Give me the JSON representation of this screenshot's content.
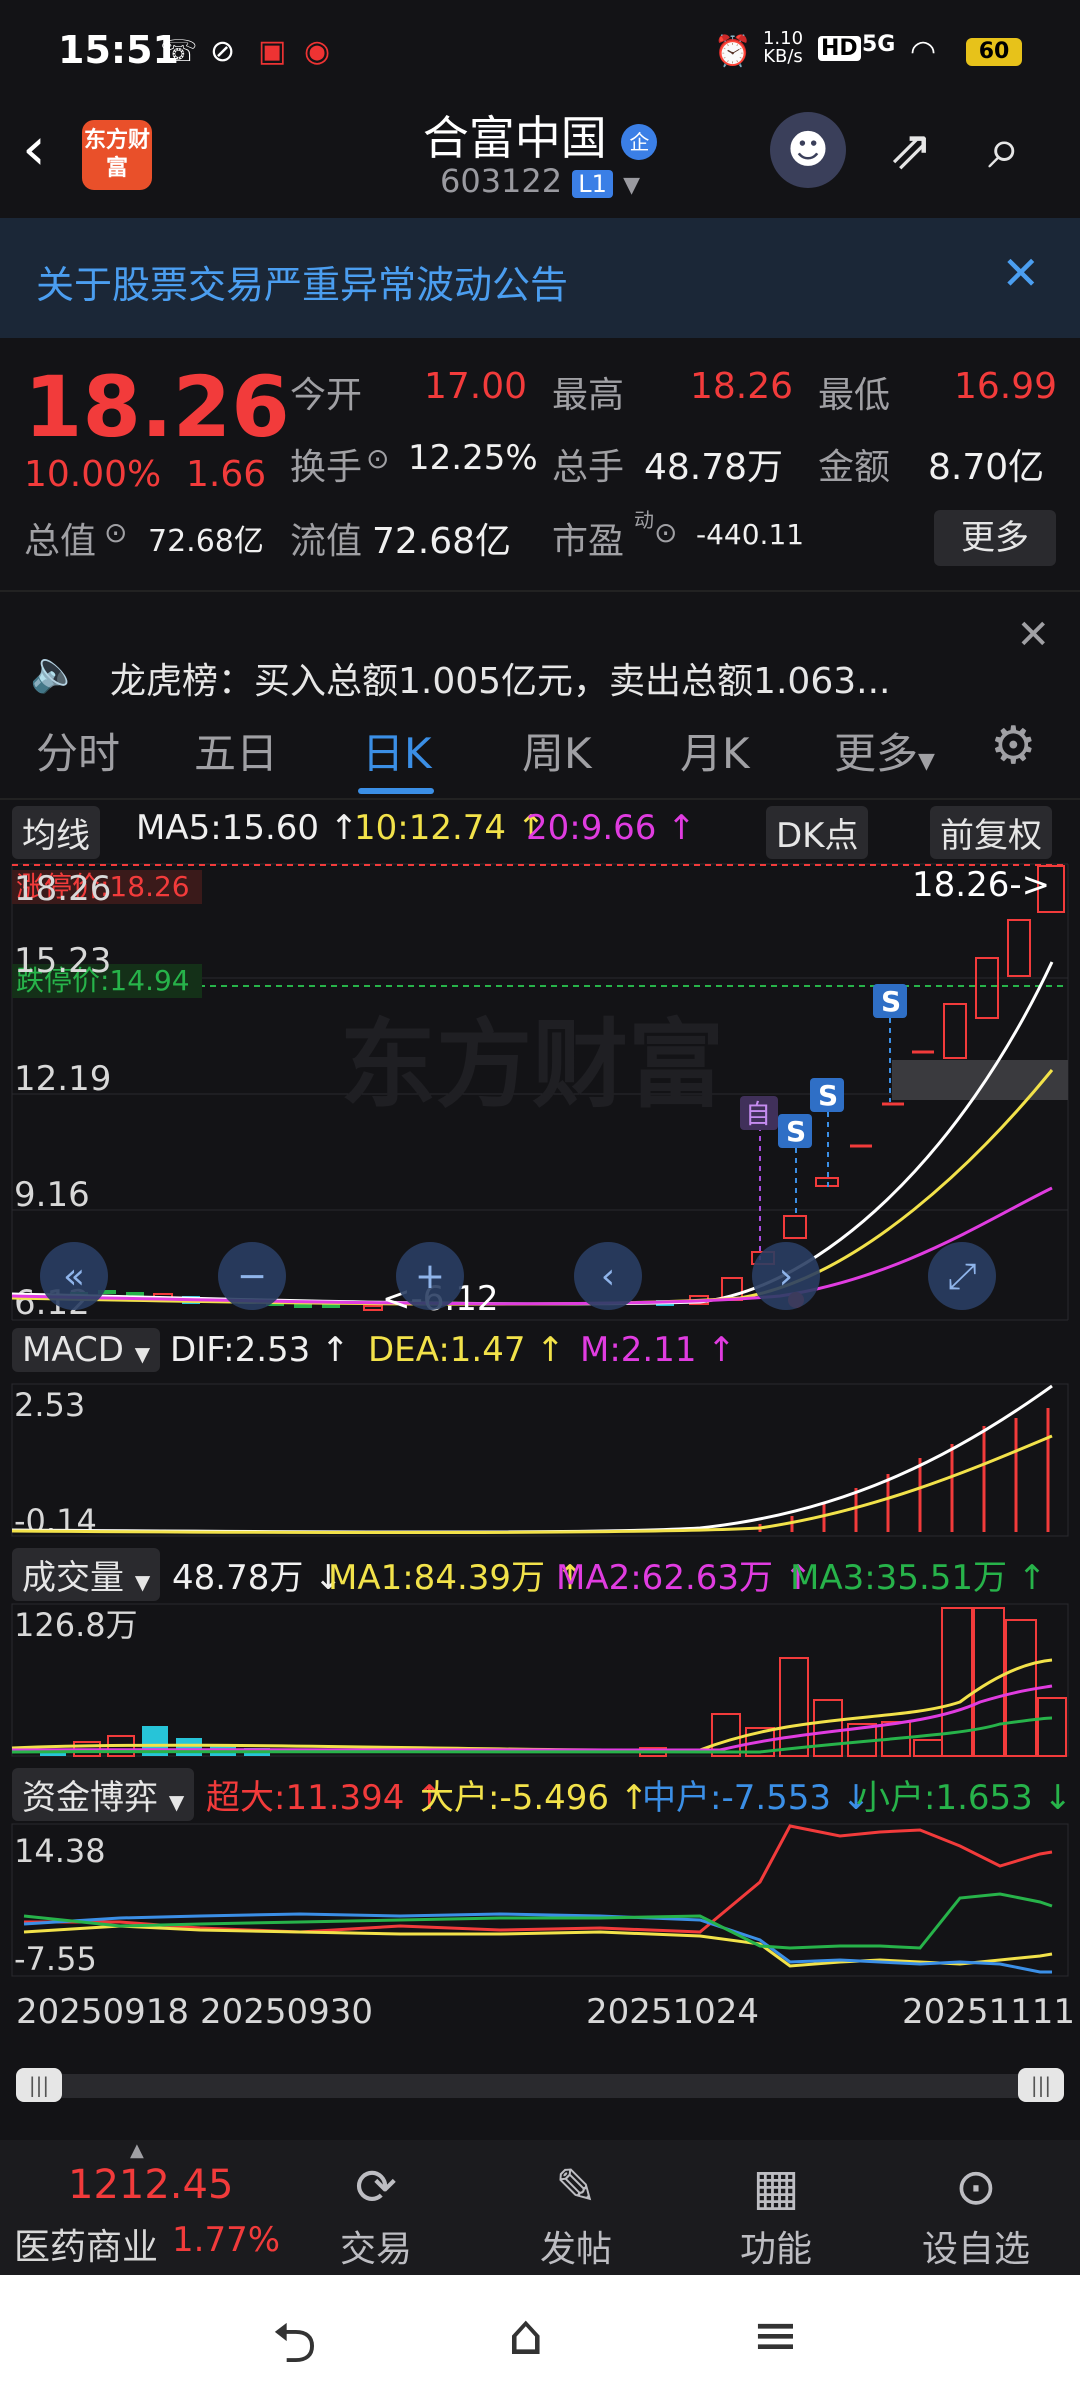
{
  "status": {
    "time": "15:51",
    "net_speed": "1.10 KB/s",
    "hd": "HD",
    "signal": "5G",
    "battery": "60"
  },
  "header": {
    "logo": "东方财富",
    "title": "合富中国",
    "corp_badge": "企",
    "code": "603122",
    "level": "L1"
  },
  "notice": {
    "text": "关于股票交易严重异常波动公告"
  },
  "quote": {
    "price": "18.26",
    "change_pct": "10.00%",
    "change": "1.66",
    "open_label": "今开",
    "open": "17.00",
    "high_label": "最高",
    "high": "18.26",
    "low_label": "最低",
    "low": "16.99",
    "turnover_label": "换手",
    "turnover": "12.25%",
    "volume_label": "总手",
    "volume": "48.78万",
    "amount_label": "金额",
    "amount": "8.70亿",
    "mcap_label": "总值",
    "mcap": "72.68亿",
    "float_label": "流值",
    "float": "72.68亿",
    "pe_label": "市盈",
    "pe_sup": "动",
    "pe": "-440.11",
    "more": "更多"
  },
  "dragon": {
    "text": "龙虎榜：买入总额1.005亿元，卖出总额1.063..."
  },
  "tabs": [
    "分时",
    "五日",
    "日K",
    "周K",
    "月K",
    "更多"
  ],
  "active_tab": 2,
  "ma_legend": {
    "label": "均线",
    "ma5": "MA5:15.60 ↑",
    "ma10": "10:12.74 ↑",
    "ma20": "20:9.66 ↑",
    "dk": "DK点",
    "fq": "前复权"
  },
  "kline": {
    "y_labels": [
      "18.26",
      "15.23",
      "12.19",
      "9.16",
      "6.12"
    ],
    "limit_up": "涨停价:18.26",
    "limit_down": "跌停价:14.94",
    "last_marker": "18.26->",
    "low_marker": "<-6.12",
    "watermark": "东方财富",
    "self_tag": "自",
    "s_tag": "S"
  },
  "macd_legend": {
    "label": "MACD",
    "dif": "DIF:2.53 ↑",
    "dea": "DEA:1.47 ↑",
    "m": "M:2.11 ↑"
  },
  "macd": {
    "y_labels": [
      "2.53",
      "-0.14"
    ]
  },
  "vol_legend": {
    "label": "成交量",
    "vol": "48.78万 ↓",
    "ma1": "MA1:84.39万 ↑",
    "ma2": "MA2:62.63万 ↑",
    "ma3": "MA3:35.51万 ↑"
  },
  "vol": {
    "y_label": "126.8万"
  },
  "fund_legend": {
    "label": "资金博弈",
    "super": "超大:11.394 ↑",
    "big": "大户:-5.496 ↑",
    "mid": "中户:-7.553 ↓",
    "small": "小户:1.653 ↓"
  },
  "fund": {
    "y_labels": [
      "14.38",
      "-7.55"
    ]
  },
  "dates": [
    "20250918",
    "20250930",
    "20251024",
    "20251111"
  ],
  "bottom": {
    "index_value": "1212.45",
    "index_name": "医药商业",
    "index_pct": "1.77%",
    "items": [
      "交易",
      "发帖",
      "功能",
      "设自选"
    ]
  },
  "colors": {
    "up": "#f23b3b",
    "down": "#27b34a",
    "accent": "#3b8fe6",
    "ma5": "#ffffff",
    "ma10": "#f2e24a",
    "ma20": "#e03ce0"
  }
}
